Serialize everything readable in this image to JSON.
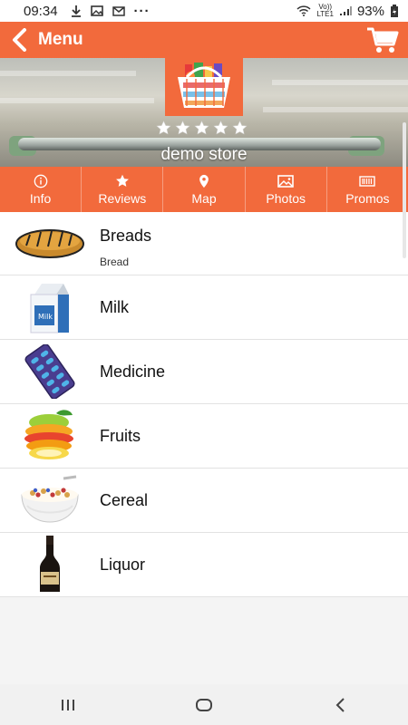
{
  "status": {
    "time": "09:34",
    "lte_top": "Vo))",
    "lte_bottom": "LTE1",
    "battery": "93%"
  },
  "header": {
    "title": "Menu"
  },
  "store": {
    "name": "demo store",
    "rating": 0,
    "max_rating": 5
  },
  "tabs": [
    {
      "label": "Info",
      "icon": "info-icon"
    },
    {
      "label": "Reviews",
      "icon": "star-icon"
    },
    {
      "label": "Map",
      "icon": "location-pin-icon"
    },
    {
      "label": "Photos",
      "icon": "photos-icon"
    },
    {
      "label": "Promos",
      "icon": "barcode-icon"
    }
  ],
  "categories": [
    {
      "name": "Breads",
      "sub": "Bread",
      "icon": "bread-icon"
    },
    {
      "name": "Milk",
      "icon": "milk-carton-icon"
    },
    {
      "name": "Medicine",
      "icon": "pill-pack-icon"
    },
    {
      "name": "Fruits",
      "icon": "fruit-slices-icon"
    },
    {
      "name": "Cereal",
      "icon": "cereal-bowl-icon"
    },
    {
      "name": "Liquor",
      "icon": "wine-bottle-icon"
    }
  ],
  "colors": {
    "accent": "#f26a3c",
    "background": "#f4f4f4"
  }
}
